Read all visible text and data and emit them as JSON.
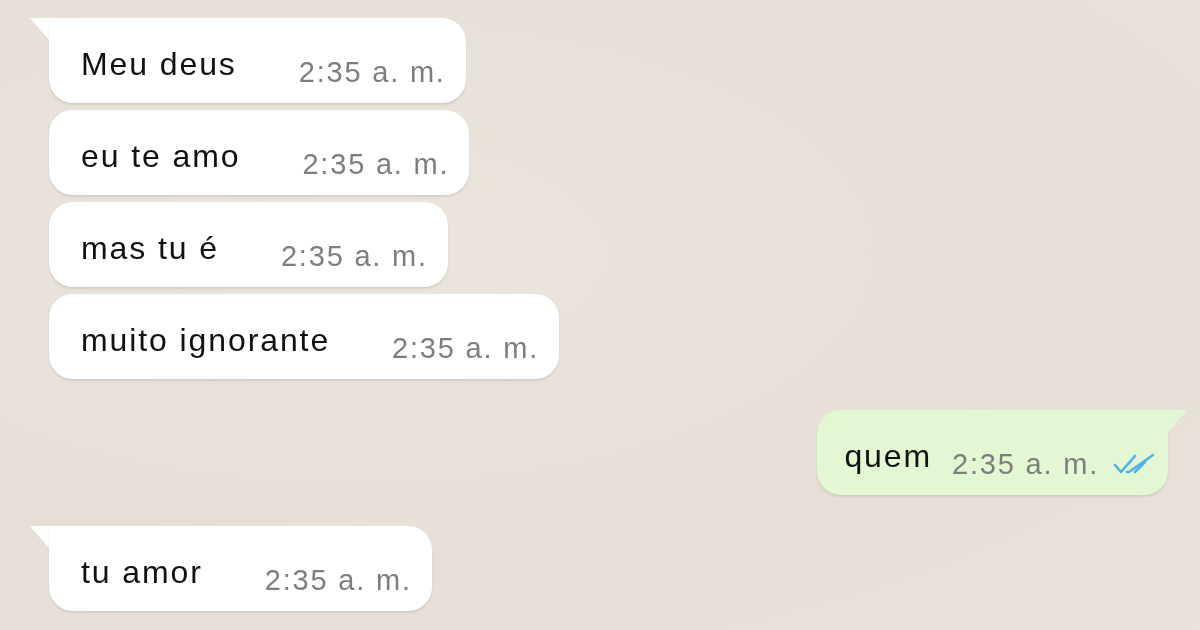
{
  "messages": [
    {
      "kind": "received",
      "tail": true,
      "text": "Meu deus",
      "time": "2:35 a. m."
    },
    {
      "kind": "received",
      "tail": false,
      "text": "eu te amo",
      "time": "2:35 a. m."
    },
    {
      "kind": "received",
      "tail": false,
      "text": "mas tu é",
      "time": "2:35 a. m."
    },
    {
      "kind": "received",
      "tail": false,
      "text": "muito ignorante",
      "time": "2:35 a. m."
    },
    {
      "kind": "sent",
      "tail": true,
      "text": "quem",
      "time": "2:35 a. m.",
      "read": true
    },
    {
      "kind": "received",
      "tail": true,
      "text": "tu amor",
      "time": "2:35 a. m."
    }
  ]
}
